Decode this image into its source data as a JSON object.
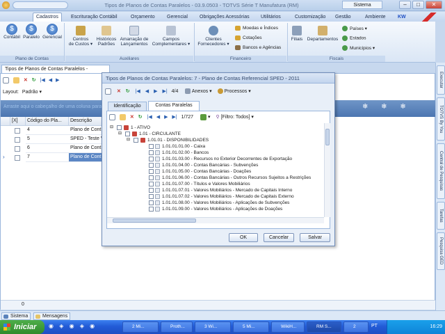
{
  "window": {
    "title": "Tipos de Planos de Contas Paralelos - 03.9.0503 - TOTVS Série T Manufatura (RM)",
    "system_label": "Sistema"
  },
  "menu_tabs": [
    "Cadastros",
    "Escrituração Contábil",
    "Orçamento",
    "Gerencial",
    "Obrigações Acessórias",
    "Utilitários",
    "Customização",
    "Gestão",
    "Ambiente"
  ],
  "menu_right": "KW",
  "ribbon": {
    "groups": [
      "Plano de Contas",
      "Auxiliares",
      "Financeiro",
      "Fiscais"
    ],
    "plano": [
      "Contábil",
      "Paralelo",
      "Gerencial"
    ],
    "aux": [
      {
        "l1": "Centros",
        "l2": "de Custos ▾"
      },
      {
        "l1": "Históricos",
        "l2": "Padrões"
      },
      {
        "l1": "Amarração de",
        "l2": "Lançamentos"
      },
      {
        "l1": "Campos",
        "l2": "Complementares ▾"
      }
    ],
    "fin_big": {
      "l1": "Clientes",
      "l2": "Fornecedores ▾"
    },
    "fin_small": [
      "Moedas e Índices",
      "Cotações",
      "Bancos e Agências"
    ],
    "fiscais_big": [
      "Filiais",
      "Departamentos"
    ],
    "fiscais_small": [
      "Países ▾",
      "Estados",
      "Municípios ▾"
    ]
  },
  "doc": {
    "tab": "Tipos de Planos de Contas Paralelos - 03.9.0503",
    "layout_label": "Layout:",
    "layout_value": "Padrão",
    "banner": "Arraste aqui o cabeçalho de uma coluna para agrupar por ela",
    "columns": [
      "[X]",
      "Código do Pla...",
      "Descrição"
    ],
    "rows": [
      {
        "code": "4",
        "desc": "Plano de Cont"
      },
      {
        "code": "5",
        "desc": "SPED - Teste V"
      },
      {
        "code": "6",
        "desc": "Plano de Cont"
      },
      {
        "code": "7",
        "desc": "Plano de Cont"
      }
    ],
    "footer_count": "0"
  },
  "dialog": {
    "title": "Tipos de Planos de Contas Paralelos: 7 - Plano de Contas Referencial SPED - 2011",
    "counter": "4/4",
    "anexos": "Anexos",
    "processos": "Processos",
    "tabs": [
      "Identificação",
      "Contas Paralelas"
    ],
    "tree_counter": "1/727",
    "filter": "[Filtro: Todos]",
    "tree": [
      "1 - ATIVO",
      "1.01 - CIRCULANTE",
      "1.01.01 - DISPONIBILIDADES",
      "1.01.01.01.00 - Caixa",
      "1.01.01.02.00 - Bancos",
      "1.01.01.03.00 - Recursos no Exterior Decorrentes de Exportação",
      "1.01.01.04.00 - Contas Bancárias - Subvenções",
      "1.01.01.05.00 - Contas Bancárias - Doações",
      "1.01.01.06.00 - Contas Bancárias - Outros Recursos Sujeitos a Restrições",
      "1.01.01.07.00 - Títulos e Valores Mobiliários",
      "1.01.01.07.01 - Valores Mobiliários - Mercado de Capitais Interno",
      "1.01.01.07.02 - Valores Mobiliários - Mercado de Capitais Externo",
      "1.01.01.08.00 - Valores Mobiliários - Aplicações de Subvenções",
      "1.01.01.09.00 - Valores Mobiliários - Aplicações de Doações"
    ],
    "buttons": [
      "OK",
      "Cancelar",
      "Salvar"
    ]
  },
  "side_tabs": [
    "Executar",
    "TOTVS By You",
    "Central de Pesquisas",
    "Tarefas",
    "Pesquisa GED"
  ],
  "bottom_tabs": [
    "Sistema",
    "Mensagens"
  ],
  "taskbar": {
    "start": "Iniciar",
    "tasks": [
      "2 Mi...",
      "Proth...",
      "3 Wi...",
      "5 Mi...",
      "WikiH...",
      "RM S..."
    ],
    "lang": "PT",
    "count": "2",
    "clock": "16:29"
  },
  "colors": {
    "ribbon_accent": "#1e4fc4",
    "tree_icon": "#c8443a",
    "banner": "#5a82bb"
  }
}
